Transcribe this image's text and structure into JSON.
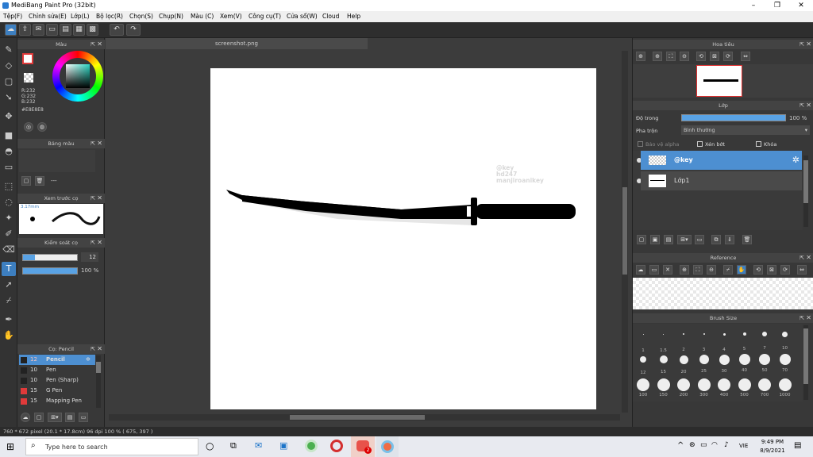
{
  "window": {
    "title": "MediBang Paint Pro (32bit)"
  },
  "menu": [
    "Tệp(F)",
    "Chỉnh sửa(E)",
    "Lớp(L)",
    "Bộ lọc(R)",
    "Chọn(S)",
    "Chụp(N)",
    "Màu (C)",
    "Xem(V)",
    "Công cụ(T)",
    "Cửa sổ(W)",
    "Cloud",
    "Help"
  ],
  "color_panel": {
    "title": "Màu",
    "r": "R:232",
    "g": "G:232",
    "b": "B:232",
    "hex": "#E8E8E8"
  },
  "palette_panel": {
    "title": "Bảng màu",
    "value": "---"
  },
  "brush_preview": {
    "title": "Xem trước cọ",
    "size": "3.17mm"
  },
  "control_panel": {
    "title": "Kiểm soát cọ",
    "size": "12",
    "opacity": "100 %"
  },
  "brush_list": {
    "title": "Cọ: Pencil",
    "items": [
      {
        "size": "12",
        "name": "Pencil",
        "color": "#222222",
        "selected": true
      },
      {
        "size": "10",
        "name": "Pen",
        "color": "#222222"
      },
      {
        "size": "10",
        "name": "Pen (Sharp)",
        "color": "#222222"
      },
      {
        "size": "15",
        "name": "G Pen",
        "color": "#e03a3a"
      },
      {
        "size": "15",
        "name": "Mapping Pen",
        "color": "#e03a3a"
      }
    ]
  },
  "canvas": {
    "tab": "screenshot.png",
    "watermark": [
      "@key",
      "hd247",
      "manjiroanikey"
    ]
  },
  "navigator": {
    "title": "Hoa tiêu"
  },
  "layer_panel": {
    "title": "Lớp",
    "opacity_label": "Độ trong",
    "opacity_value": "100 %",
    "blend_label": "Pha trộn",
    "blend_value": "Bình thường",
    "protect_alpha": "Bảo vệ alpha",
    "clipping": "Xén bớt",
    "lock": "Khóa",
    "layers": [
      {
        "name": "@key",
        "selected": true
      },
      {
        "name": "Lớp1",
        "selected": false
      }
    ]
  },
  "reference": {
    "title": "Reference"
  },
  "brush_size": {
    "title": "Brush Size",
    "labels": [
      "1",
      "1.5",
      "2",
      "3",
      "4",
      "5",
      "7",
      "10",
      "12",
      "15",
      "20",
      "25",
      "30",
      "40",
      "50",
      "70",
      "100",
      "150",
      "200",
      "300",
      "400",
      "500",
      "700",
      "1000"
    ]
  },
  "status": {
    "text": "760 * 672 pixel  (20.1 * 17.8cm)  96 dpi  100 %  ( 675, 397 )"
  },
  "taskbar": {
    "search": "Type here to search",
    "time": "9:49 PM",
    "date": "8/9/2021",
    "lang": "VIE",
    "notif": "2"
  }
}
